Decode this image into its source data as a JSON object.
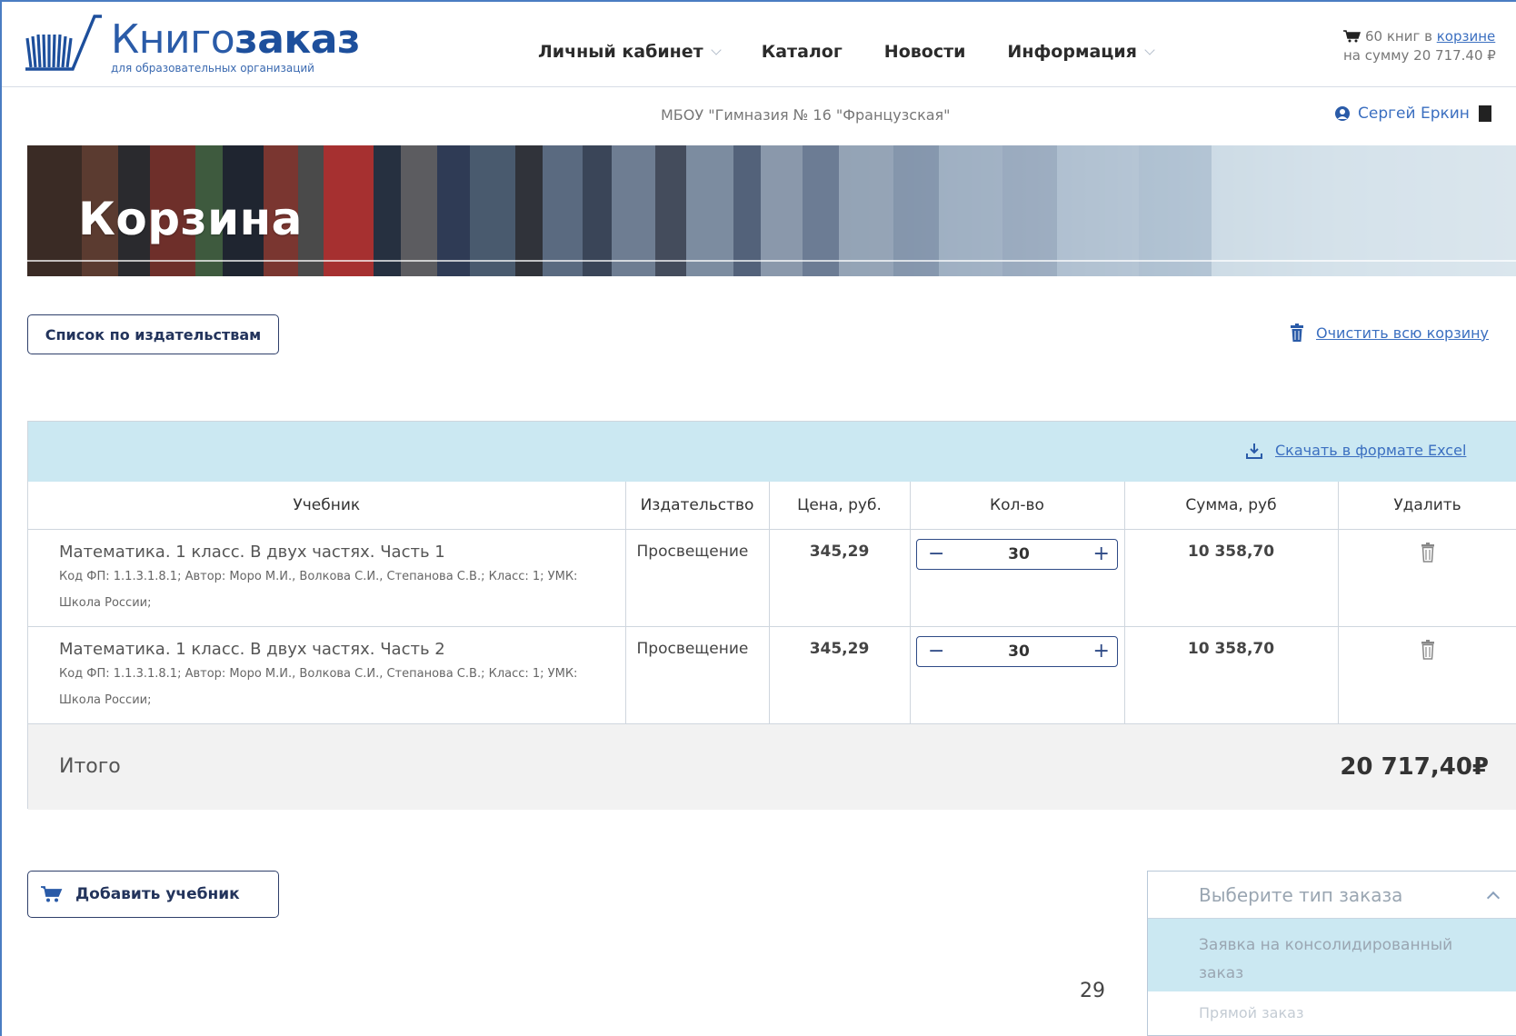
{
  "header": {
    "logo_title_light": "Книго",
    "logo_title_bold": "заказ",
    "logo_subtitle": "для образовательных организаций",
    "nav": [
      {
        "label": "Личный кабинет",
        "has_dropdown": true
      },
      {
        "label": "Каталог",
        "has_dropdown": false
      },
      {
        "label": "Новости",
        "has_dropdown": false
      },
      {
        "label": "Информация",
        "has_dropdown": true
      }
    ],
    "cart_summary_line1_prefix": "60 книг в ",
    "cart_summary_line1_link": "корзине",
    "cart_summary_line2": "на сумму 20 717.40 ₽"
  },
  "subbar": {
    "organization": "МБОУ \"Гимназия № 16 \"Французская\"",
    "user_name": "Сергей Еркин"
  },
  "banner": {
    "title": "Корзина"
  },
  "actions": {
    "publishers_list_label": "Список по издательствам",
    "clear_cart_label": "Очистить всю корзину",
    "excel_label": "Скачать в формате Excel"
  },
  "table": {
    "columns": [
      "Учебник",
      "Издательство",
      "Цена, руб.",
      "Кол-во",
      "Сумма, руб",
      "Удалить"
    ],
    "rows": [
      {
        "title": "Математика. 1 класс. В двух частях. Часть 1",
        "meta": "Код ФП: 1.1.3.1.8.1; Автор: Моро М.И., Волкова С.И., Степанова С.В.; Класс: 1; УМК: Школа России;",
        "publisher": "Просвещение",
        "price": "345,29",
        "qty": "30",
        "sum": "10 358,70"
      },
      {
        "title": "Математика. 1 класс. В двух частях. Часть 2",
        "meta": "Код ФП: 1.1.3.1.8.1; Автор: Моро М.И., Волкова С.И., Степанова С.В.; Класс: 1; УМК: Школа России;",
        "publisher": "Просвещение",
        "price": "345,29",
        "qty": "30",
        "sum": "10 358,70"
      }
    ],
    "total_label": "Итого",
    "total_value": "20 717,40₽"
  },
  "bottom": {
    "add_book_label": "Добавить учебник",
    "order_type_placeholder": "Выберите тип заказа",
    "order_type_options": [
      "Заявка на консолидированный заказ",
      "Прямой заказ"
    ],
    "page_number": "29"
  },
  "colors": {
    "brand_blue": "#2a5ba8",
    "link_blue": "#3b6fc0",
    "table_header_bg": "#cbe8f2",
    "button_border": "#2e3f6a"
  }
}
